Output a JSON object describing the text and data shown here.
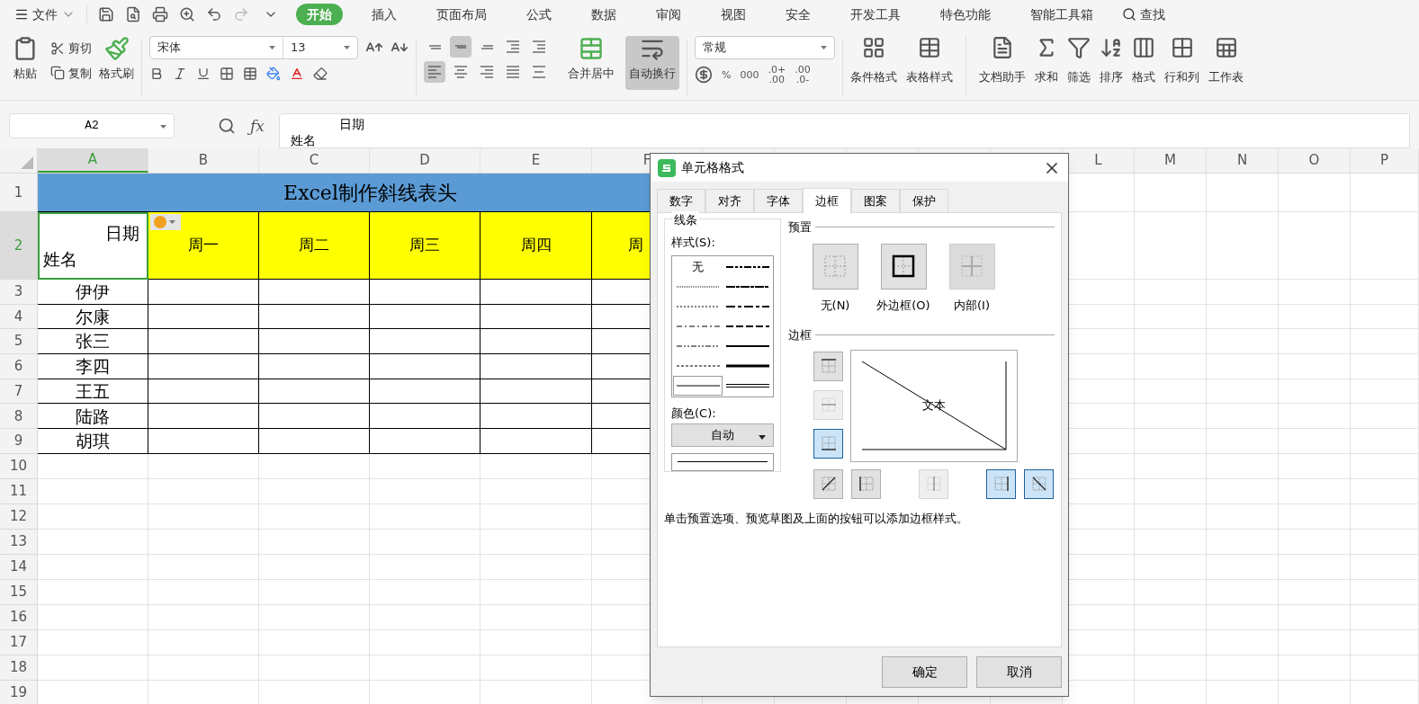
{
  "menu_bar": {
    "file_label": "文件",
    "tabs": [
      {
        "label": "开始",
        "selected": true
      },
      {
        "label": "插入",
        "selected": false
      },
      {
        "label": "页面布局",
        "selected": false
      },
      {
        "label": "公式",
        "selected": false
      },
      {
        "label": "数据",
        "selected": false
      },
      {
        "label": "审阅",
        "selected": false
      },
      {
        "label": "视图",
        "selected": false
      },
      {
        "label": "安全",
        "selected": false
      },
      {
        "label": "开发工具",
        "selected": false
      },
      {
        "label": "特色功能",
        "selected": false
      },
      {
        "label": "智能工具箱",
        "selected": false
      }
    ],
    "search": "查找"
  },
  "ribbon": {
    "paste": "粘贴",
    "cut": "剪切",
    "copy": "复制",
    "format_painter": "格式刷",
    "font_name": "宋体",
    "font_size": "13",
    "align_buttons": [
      {
        "kind": "top",
        "selected": false
      },
      {
        "kind": "middle",
        "selected": true
      },
      {
        "kind": "bottom",
        "selected": false
      },
      {
        "kind": "outdent",
        "selected": false
      },
      {
        "kind": "indent",
        "selected": false
      },
      {
        "kind": "left",
        "selected": true
      },
      {
        "kind": "center",
        "selected": false
      },
      {
        "kind": "right",
        "selected": false
      },
      {
        "kind": "justify",
        "selected": false
      },
      {
        "kind": "distribute",
        "selected": false
      }
    ],
    "merge": {
      "label": "合并居中",
      "selected": false
    },
    "wrap": {
      "label": "自动换行",
      "selected": true
    },
    "number_format": "常规",
    "number_buttons": [
      [
        "%"
      ],
      [
        "000"
      ],
      [
        ".0+",
        ".00"
      ],
      [
        ".00",
        ".0-"
      ]
    ],
    "big_buttons": [
      {
        "kind": "conditional",
        "label": "条件格式"
      },
      {
        "kind": "table-style",
        "label": "表格样式"
      },
      {
        "kind": "doc",
        "label": "文档助手"
      },
      {
        "kind": "sum",
        "label": "求和"
      },
      {
        "kind": "filter",
        "label": "筛选"
      },
      {
        "kind": "sort",
        "label": "排序"
      },
      {
        "kind": "format",
        "label": "格式"
      },
      {
        "kind": "rowcol",
        "label": "行和列"
      },
      {
        "kind": "sheet",
        "label": "工作表"
      }
    ]
  },
  "formula_bar": {
    "name_box": "A2",
    "fx_label": "ƒx",
    "lines": [
      "日期",
      "姓名"
    ]
  },
  "columns": [
    {
      "label": "A",
      "selected": true
    },
    {
      "label": "B",
      "selected": false
    },
    {
      "label": "C",
      "selected": false
    },
    {
      "label": "D",
      "selected": false
    },
    {
      "label": "E",
      "selected": false
    },
    {
      "label": "F",
      "selected": false
    },
    {
      "label": "L",
      "selected": false
    },
    {
      "label": "M",
      "selected": false
    },
    {
      "label": "N",
      "selected": false
    },
    {
      "label": "O",
      "selected": false
    },
    {
      "label": "P",
      "selected": false
    }
  ],
  "rows": [
    {
      "header": "1",
      "kind": "title",
      "selected": false,
      "text": "Excel制作斜线表头"
    },
    {
      "header": "2",
      "kind": "head",
      "selected": true,
      "a_top": "日期",
      "a_bottom": "姓名",
      "cells": [
        "周一",
        "周二",
        "周三",
        "周四",
        "周"
      ]
    },
    {
      "header": "3",
      "kind": "data",
      "selected": false,
      "name": "伊伊"
    },
    {
      "header": "4",
      "kind": "data",
      "selected": false,
      "name": "尔康"
    },
    {
      "header": "5",
      "kind": "data",
      "selected": false,
      "name": "张三"
    },
    {
      "header": "6",
      "kind": "data",
      "selected": false,
      "name": "李四"
    },
    {
      "header": "7",
      "kind": "data",
      "selected": false,
      "name": "王五"
    },
    {
      "header": "8",
      "kind": "data",
      "selected": false,
      "name": "陆路"
    },
    {
      "header": "9",
      "kind": "data",
      "selected": false,
      "name": "胡琪"
    },
    {
      "header": "10",
      "kind": "blank",
      "selected": false
    },
    {
      "header": "11",
      "kind": "blank",
      "selected": false
    },
    {
      "header": "12",
      "kind": "blank",
      "selected": false
    },
    {
      "header": "13",
      "kind": "blank",
      "selected": false
    },
    {
      "header": "14",
      "kind": "blank",
      "selected": false
    },
    {
      "header": "15",
      "kind": "blank",
      "selected": false
    },
    {
      "header": "16",
      "kind": "blank",
      "selected": false
    },
    {
      "header": "17",
      "kind": "blank",
      "selected": false
    },
    {
      "header": "18",
      "kind": "blank",
      "selected": false
    },
    {
      "header": "19",
      "kind": "blank",
      "selected": false
    }
  ],
  "dialog": {
    "title": "单元格格式",
    "tabs": [
      {
        "label": "数字",
        "selected": false
      },
      {
        "label": "对齐",
        "selected": false
      },
      {
        "label": "字体",
        "selected": false
      },
      {
        "label": "边框",
        "selected": true
      },
      {
        "label": "图案",
        "selected": false
      },
      {
        "label": "保护",
        "selected": false
      }
    ],
    "lines_legend": "线条",
    "style_label": "样式(S):",
    "line_styles": [
      {
        "kind": "none",
        "label": "无",
        "selected": false
      },
      {
        "kind": "mdashdotdot",
        "selected": false
      },
      {
        "kind": "hair",
        "selected": false
      },
      {
        "kind": "slant",
        "selected": false
      },
      {
        "kind": "dotted",
        "selected": false
      },
      {
        "kind": "mdashdot",
        "selected": false
      },
      {
        "kind": "dashdot",
        "selected": false
      },
      {
        "kind": "mdashed",
        "selected": false
      },
      {
        "kind": "dashdotdot",
        "selected": false
      },
      {
        "kind": "medium",
        "selected": false
      },
      {
        "kind": "dashed",
        "selected": false
      },
      {
        "kind": "thick",
        "selected": false
      },
      {
        "kind": "thin",
        "selected": true
      },
      {
        "kind": "double",
        "selected": false
      }
    ],
    "color_label": "颜色(C):",
    "color_value": "自动",
    "preset_legend": "预置",
    "presets": [
      {
        "kind": "none",
        "label": "无(N)",
        "disabled": false
      },
      {
        "kind": "outline",
        "label": "外边框(O)",
        "disabled": false
      },
      {
        "kind": "inside",
        "label": "内部(I)",
        "disabled": true
      }
    ],
    "border_legend": "边框",
    "side_buttons": [
      {
        "kind": "top",
        "selected": false,
        "disabled": false
      },
      {
        "kind": "middle",
        "selected": false,
        "disabled": true
      },
      {
        "kind": "bottom",
        "selected": true,
        "disabled": false
      }
    ],
    "bottom_buttons": [
      {
        "kind": "diag-up",
        "selected": false,
        "disabled": false
      },
      {
        "kind": "left",
        "selected": false,
        "disabled": false
      },
      {
        "kind": "center",
        "selected": false,
        "disabled": true
      },
      {
        "kind": "right",
        "selected": true,
        "disabled": false
      },
      {
        "kind": "diag-down",
        "selected": true,
        "disabled": false
      }
    ],
    "preview_text": "文本",
    "hint": "单击预置选项、预览草图及上面的按钮可以添加边框样式。",
    "ok": "确定",
    "cancel": "取消"
  }
}
